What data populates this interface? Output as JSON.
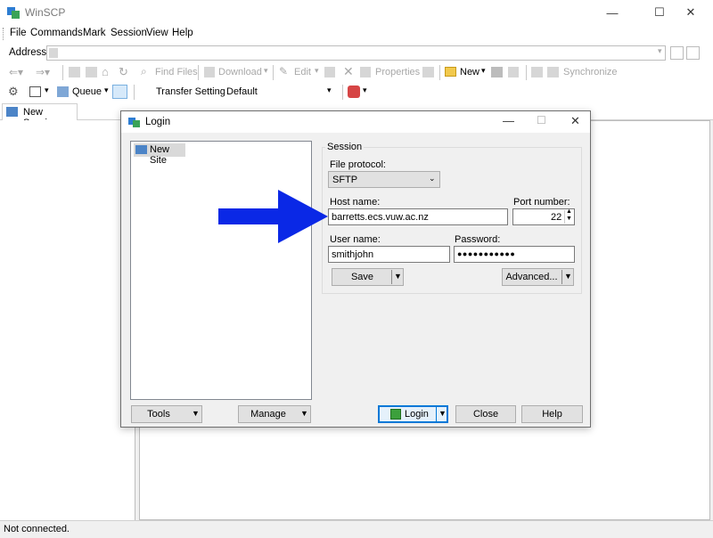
{
  "window": {
    "title": "WinSCP",
    "minimize": "—",
    "maximize": "☐",
    "close": "✕"
  },
  "menu": [
    "File",
    "Commands",
    "Mark",
    "Session",
    "View",
    "Help"
  ],
  "address": {
    "label": "Address"
  },
  "toolbar1": {
    "find_files": "Find Files",
    "download": "Download",
    "edit": "Edit",
    "properties": "Properties",
    "new": "New",
    "synchronize": "Synchronize"
  },
  "toolbar2": {
    "queue": "Queue",
    "transfer_settings_label": "Transfer Settings",
    "transfer_settings_value": "Default"
  },
  "tabs": {
    "new_session": "New Session"
  },
  "status": {
    "text": "Not connected."
  },
  "login": {
    "title": "Login",
    "site_tree": {
      "items": [
        "New Site"
      ]
    },
    "session_group": "Session",
    "file_protocol_label": "File protocol:",
    "file_protocol_value": "SFTP",
    "host_name_label": "Host name:",
    "host_name_value": "barretts.ecs.vuw.ac.nz",
    "port_label": "Port number:",
    "port_value": "22",
    "user_name_label": "User name:",
    "user_name_value": "smithjohn",
    "password_label": "Password:",
    "password_value": "●●●●●●●●●●●",
    "save_button": "Save",
    "advanced_button": "Advanced...",
    "tools_button": "Tools",
    "manage_button": "Manage",
    "login_button": "Login",
    "close_button": "Close",
    "help_button": "Help"
  },
  "colors": {
    "arrow": "#0a28e6",
    "focus": "#0078d7",
    "login_icon": "#3ca03c"
  }
}
